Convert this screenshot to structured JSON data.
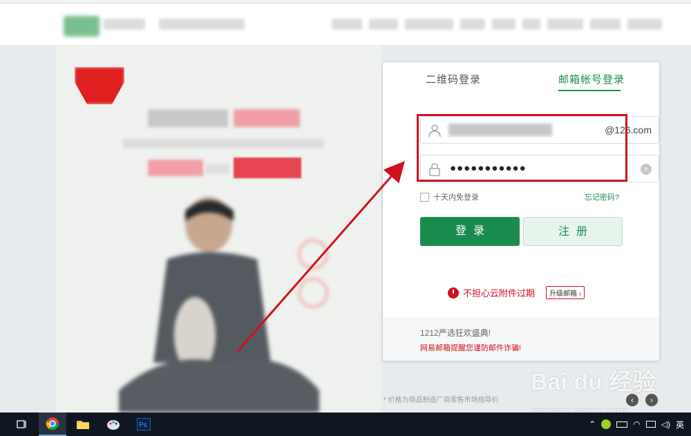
{
  "login": {
    "tab_qr": "二维码登录",
    "tab_email": "邮箱帐号登录",
    "domain_suffix": "@126.com",
    "password_masked": "●●●●●●●●●●●",
    "remember": "十天内免登录",
    "forgot": "忘记密码?",
    "login_btn": "登录",
    "register_btn": "注册",
    "notice": "不担心云附件过期",
    "upgrade": "升级邮箱",
    "promo_line": "1212严选狂欢盛典!",
    "warning": "网易邮箱提醒您谨防邮件诈骗!"
  },
  "promo": {
    "price_note": "* 价格为商品制造厂商零售市场指导价"
  },
  "watermark": {
    "main": "Bai du 经验",
    "sub": "jingyan.baidu.com"
  },
  "taskbar": {
    "lang": "英"
  },
  "colors": {
    "accent": "#1a8c4e",
    "alert": "#d0101e"
  }
}
